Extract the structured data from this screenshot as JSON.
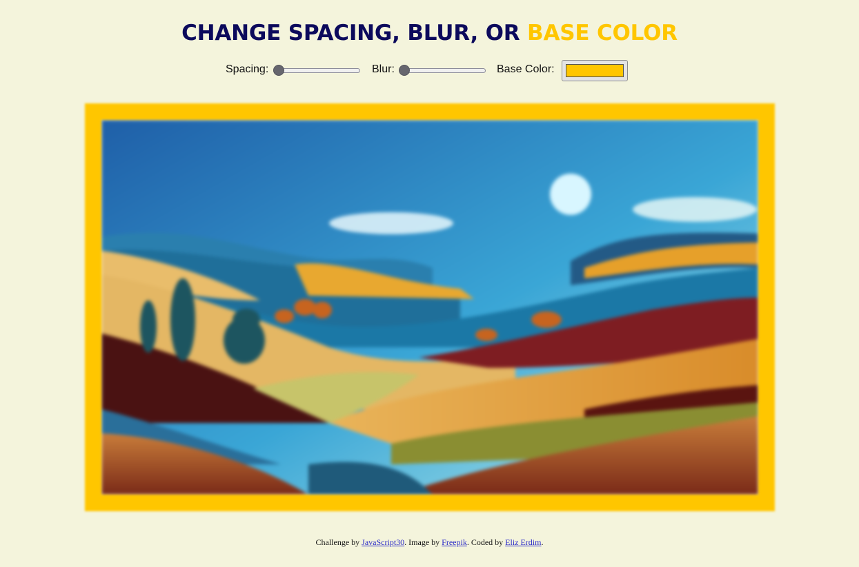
{
  "header": {
    "title_main": "CHANGE SPACING, BLUR, OR ",
    "title_highlight": "BASE COLOR"
  },
  "controls": {
    "spacing": {
      "label": "Spacing:",
      "value": 0
    },
    "blur": {
      "label": "Blur:",
      "value": 0
    },
    "base_color": {
      "label": "Base Color:",
      "value": "#ffc600"
    }
  },
  "colors": {
    "background": "#f4f4dc",
    "title": "#0c0a5c",
    "accent": "#ffc600",
    "link": "#2a2ac8"
  },
  "image": {
    "subject": "landscape-illustration"
  },
  "footer": {
    "prefix": "Challenge by ",
    "link1": "JavaScript30",
    "mid1": ". Image by ",
    "link2": "Freepik",
    "mid2": ". Coded by ",
    "link3": "Eliz Erdim",
    "suffix": "."
  }
}
